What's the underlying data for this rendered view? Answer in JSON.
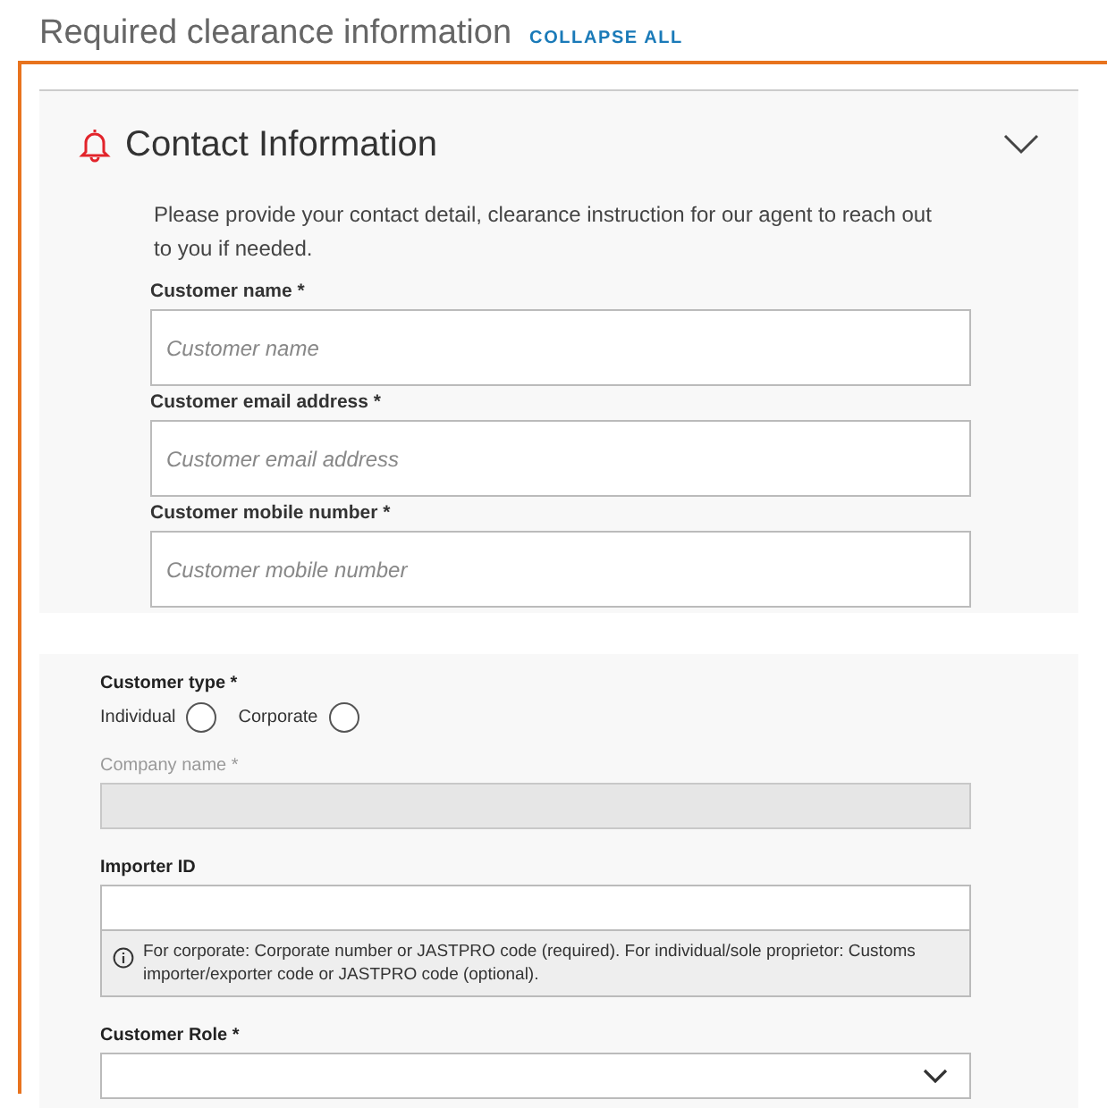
{
  "heading": {
    "title": "Required clearance information",
    "action": "COLLAPSE ALL"
  },
  "contact_section": {
    "title": "Contact Information",
    "expanded": true,
    "description": "Please provide your contact detail, clearance instruction for our agent to reach out to you if needed.",
    "fields": [
      {
        "label": "Customer name *",
        "placeholder": "Customer name"
      },
      {
        "label": "Customer email address *",
        "placeholder": "Customer email address"
      },
      {
        "label": "Customer mobile number *",
        "placeholder": "Customer mobile number"
      }
    ]
  },
  "customer_details": {
    "customer_type": {
      "label": "Customer type *",
      "options": [
        {
          "label": "Individual",
          "selected": false
        },
        {
          "label": "Corporate",
          "selected": false
        }
      ]
    },
    "fields": [
      {
        "kind": "text",
        "label": "Company name *",
        "disabled": true
      },
      {
        "kind": "text",
        "label": "Importer ID",
        "disabled": false,
        "hint": "For corporate: Corporate number or JASTPRO code (required). For individual/sole proprietor: Customs importer/exporter code or JASTPRO code (optional)."
      },
      {
        "kind": "select",
        "label": "Customer Role *",
        "disabled": false
      }
    ]
  }
}
